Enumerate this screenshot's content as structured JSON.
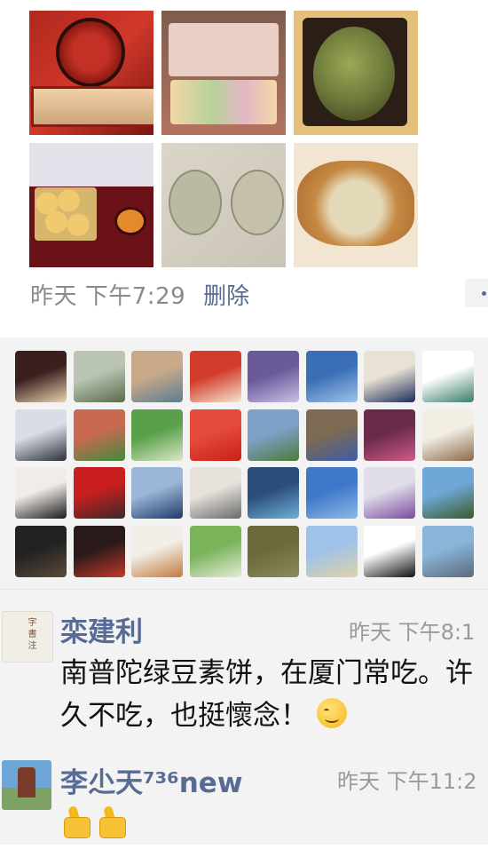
{
  "post": {
    "time": "昨天 下午7:29",
    "delete_label": "删除"
  },
  "likes": {
    "avatars": [
      {
        "colors": [
          "#3b1e1e",
          "#e6d3b0"
        ]
      },
      {
        "colors": [
          "#b9c5b2",
          "#5a6a4a"
        ]
      },
      {
        "colors": [
          "#c8a98a",
          "#5b7d90"
        ]
      },
      {
        "colors": [
          "#d33b2a",
          "#f3e6cf"
        ]
      },
      {
        "colors": [
          "#6a5a9a",
          "#c9c0e6"
        ]
      },
      {
        "colors": [
          "#3a6fb5",
          "#9fc2e8"
        ]
      },
      {
        "colors": [
          "#e8e2d4",
          "#1b2b5a"
        ]
      },
      {
        "colors": [
          "#ffffff",
          "#3a7d6a"
        ]
      },
      {
        "colors": [
          "#d8dde6",
          "#2a2f3a"
        ]
      },
      {
        "colors": [
          "#c96a50",
          "#3f8b3f"
        ]
      },
      {
        "colors": [
          "#5aa04a",
          "#d9e7c8"
        ]
      },
      {
        "colors": [
          "#e54a3a",
          "#c82018"
        ]
      },
      {
        "colors": [
          "#7ea1c8",
          "#4e7a3a"
        ]
      },
      {
        "colors": [
          "#7d6a52",
          "#3b5da8"
        ]
      },
      {
        "colors": [
          "#6a2a4a",
          "#d05a8a"
        ]
      },
      {
        "colors": [
          "#f2eee4",
          "#8a6a4a"
        ]
      },
      {
        "colors": [
          "#f0ece8",
          "#1a1a1a"
        ]
      },
      {
        "colors": [
          "#c81e1e",
          "#3a2a2a"
        ]
      },
      {
        "colors": [
          "#9ab7d8",
          "#1f3b6a"
        ]
      },
      {
        "colors": [
          "#e7e3dc",
          "#6a6a6a"
        ]
      },
      {
        "colors": [
          "#2a4d7a",
          "#6fb0d8"
        ]
      },
      {
        "colors": [
          "#3f78c8",
          "#8db8e8"
        ]
      },
      {
        "colors": [
          "#e0dce8",
          "#7a4aa0"
        ]
      },
      {
        "colors": [
          "#6fa8d8",
          "#3a5a2a"
        ]
      },
      {
        "colors": [
          "#222222",
          "#5a4a3a"
        ]
      },
      {
        "colors": [
          "#2a1a1a",
          "#c23a2a"
        ]
      },
      {
        "colors": [
          "#f2eee8",
          "#c27a3a"
        ]
      },
      {
        "colors": [
          "#7ab35a",
          "#e2ecd8"
        ]
      },
      {
        "colors": [
          "#6a6a3a",
          "#8a8a5a"
        ]
      },
      {
        "colors": [
          "#9fc3e8",
          "#e0d2a8"
        ]
      },
      {
        "colors": [
          "#ffffff",
          "#111111"
        ]
      },
      {
        "colors": [
          "#8ab4d8",
          "#5a6a7a"
        ]
      }
    ]
  },
  "comments": [
    {
      "name": "栾建利",
      "time": "昨天 下午8:1",
      "text": "南普陀绿豆素饼，在厦门常吃。许久不吃，也挺懷念！"
    },
    {
      "name": "李尐天⁷³⁶new",
      "time": "昨天 下午11:2",
      "text": ""
    }
  ],
  "icons": {
    "emoji": "smile-emoji-icon",
    "thumbs": "thumbs-up-icon",
    "more": "more-dots-icon"
  }
}
